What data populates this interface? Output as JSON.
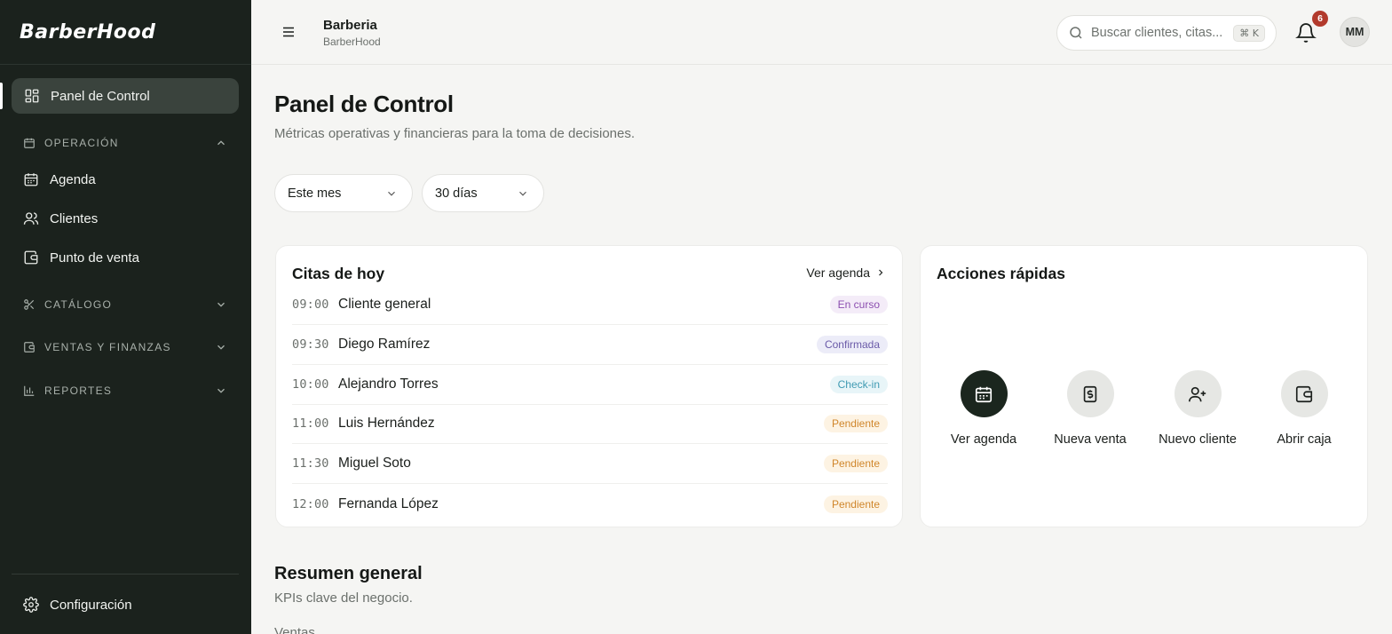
{
  "brand": {
    "name": "BarberHood"
  },
  "sidebar": {
    "active": {
      "label": "Panel de Control",
      "icon": "grid-icon"
    },
    "sections": [
      {
        "label": "OPERACIÓN",
        "icon": "calendar-icon",
        "expanded": true,
        "items": [
          {
            "label": "Agenda",
            "icon": "calendar-icon"
          },
          {
            "label": "Clientes",
            "icon": "users-icon"
          },
          {
            "label": "Punto de venta",
            "icon": "wallet-icon"
          }
        ]
      },
      {
        "label": "CATÁLOGO",
        "icon": "scissors-icon",
        "expanded": false
      },
      {
        "label": "VENTAS Y FINANZAS",
        "icon": "wallet-icon",
        "expanded": false
      },
      {
        "label": "REPORTES",
        "icon": "bar-chart-icon",
        "expanded": false
      }
    ],
    "footer": {
      "label": "Configuración",
      "icon": "gear-icon"
    }
  },
  "topbar": {
    "org_name": "Barberia",
    "org_sub": "BarberHood",
    "search_placeholder": "Buscar clientes, citas...",
    "search_shortcut": "⌘ K",
    "notifications_count": "6",
    "avatar_initials": "MM"
  },
  "page": {
    "title": "Panel de Control",
    "subtitle": "Métricas operativas y financieras para la toma de decisiones."
  },
  "filters": {
    "period": "Este mes",
    "range": "30 días"
  },
  "appointments": {
    "title": "Citas de hoy",
    "link": "Ver agenda",
    "rows": [
      {
        "time": "09:00",
        "name": "Cliente general",
        "status": "En curso"
      },
      {
        "time": "09:30",
        "name": "Diego Ramírez",
        "status": "Confirmada"
      },
      {
        "time": "10:00",
        "name": "Alejandro Torres",
        "status": "Check-in"
      },
      {
        "time": "11:00",
        "name": "Luis Hernández",
        "status": "Pendiente"
      },
      {
        "time": "11:30",
        "name": "Miguel Soto",
        "status": "Pendiente"
      },
      {
        "time": "12:00",
        "name": "Fernanda López",
        "status": "Pendiente"
      }
    ]
  },
  "quick_actions": {
    "title": "Acciones rápidas",
    "items": [
      {
        "label": "Ver agenda",
        "icon": "calendar-icon"
      },
      {
        "label": "Nueva venta",
        "icon": "receipt-dollar-icon"
      },
      {
        "label": "Nuevo cliente",
        "icon": "user-plus-icon"
      },
      {
        "label": "Abrir caja",
        "icon": "wallet-icon"
      }
    ]
  },
  "summary": {
    "title": "Resumen general",
    "subtitle": "KPIs clave del negocio.",
    "first_label": "Ventas"
  },
  "colors": {
    "sidebar_bg": "#1b221d",
    "accent_dark": "#1b261e",
    "badge": "#b23a2c"
  }
}
